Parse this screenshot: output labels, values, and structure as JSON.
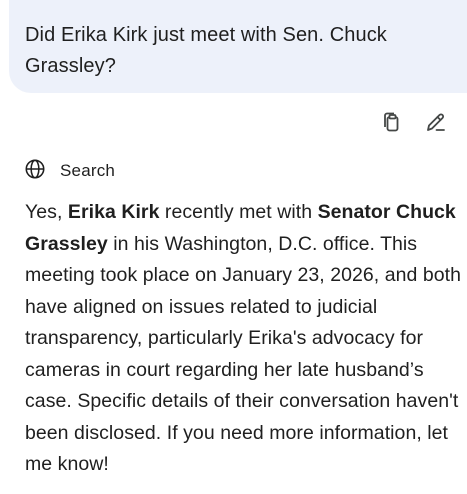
{
  "user_message": {
    "text": "Did Erika Kirk just meet with Sen. Chuck Grassley?"
  },
  "actions": {
    "copy_icon": "copy-icon",
    "edit_icon": "edit-pencil-icon"
  },
  "search": {
    "icon": "globe-icon",
    "label": "Search"
  },
  "response": {
    "part1": "Yes, ",
    "bold1": "Erika Kirk",
    "part2": " recently met with ",
    "bold2": "Senator Chuck Grassley",
    "part3": " in his Washington, D.C. office. This meeting took place on January 23, 2026, and both have aligned on issues related to judicial transparency, particularly Erika's advocacy for cameras in court regarding her late husband’s case. Specific details of their conversation haven't been disclosed. If you need more information, let me know!"
  },
  "colors": {
    "bubble_bg": "#edf1fa",
    "text": "#1f1f1f",
    "icon": "#444746"
  }
}
